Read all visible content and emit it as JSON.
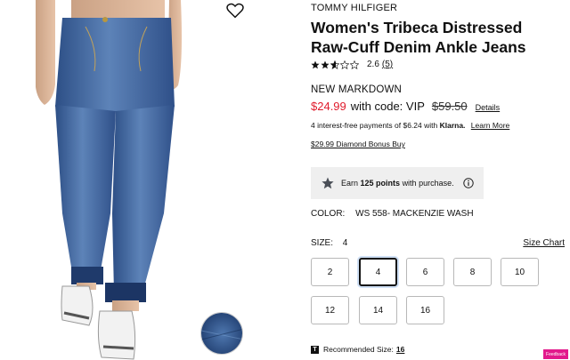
{
  "product": {
    "brand": "TOMMY HILFIGER",
    "title": "Women's Tribeca Distressed Raw-Cuff Denim Ankle Jeans",
    "rating_value": "2.6",
    "review_count": "(5)",
    "rating_stars": 2.6
  },
  "pricing": {
    "markdown_label": "NEW MARKDOWN",
    "sale_price": "$24.99",
    "code_label": "with code: VIP",
    "original_price": "$59.50",
    "details_link": "Details",
    "sale_color": "#e01a2b"
  },
  "klarna": {
    "text": "4 interest-free payments of $6.24 with",
    "brand": "Klarna.",
    "learn_more": "Learn More"
  },
  "bonus": {
    "label": "$29.99 Diamond Bonus Buy"
  },
  "points": {
    "prefix": "Earn",
    "amount": "125 points",
    "suffix": "with purchase.",
    "icon": "star-icon"
  },
  "color": {
    "label": "COLOR:",
    "value": "WS 558- MACKENZIE WASH"
  },
  "size": {
    "label": "SIZE:",
    "selected": "4",
    "chart_link": "Size Chart",
    "options": [
      "2",
      "4",
      "6",
      "8",
      "10",
      "12",
      "14",
      "16"
    ]
  },
  "recommended": {
    "label": "Recommended Size:",
    "value": "16"
  },
  "feedback": {
    "label": "Feedback"
  }
}
